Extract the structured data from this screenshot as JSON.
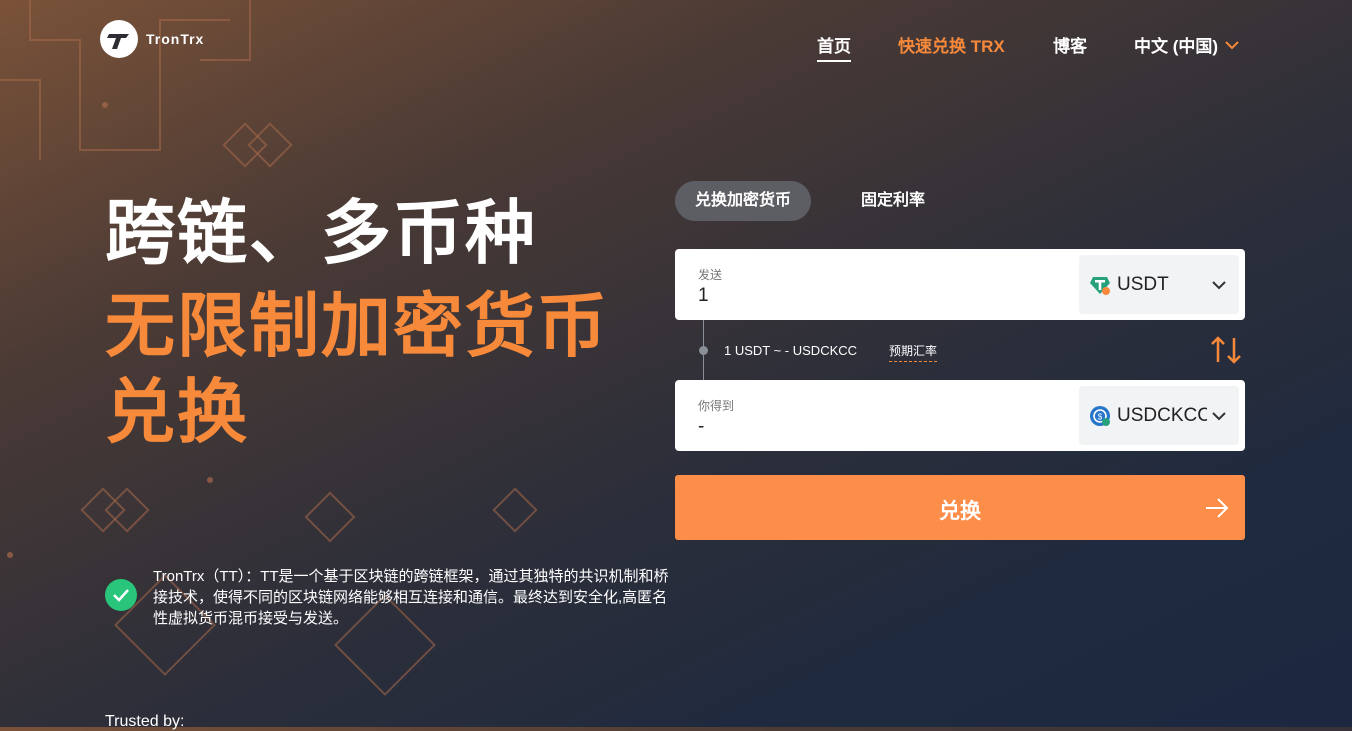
{
  "brand": {
    "name": "TronTrx"
  },
  "nav": {
    "home": "首页",
    "swap": "快速兑换 TRX",
    "blog": "博客",
    "language": "中文 (中国)"
  },
  "hero": {
    "line1": "跨链、多币种",
    "line2": "无限制加密货币",
    "line3": "兑换"
  },
  "description": "TronTrx（TT）：TT是一个基于区块链的跨链框架，通过其独特的共识机制和桥接技术，使得不同的区块链网络能够相互连接和通信。最终达到安全化,高匿名性虚拟货币混币接受与发送。",
  "trusted_by": "Trusted by:",
  "exchange": {
    "tabs": [
      "兑换加密货币",
      "固定利率"
    ],
    "send": {
      "label": "发送",
      "value": "1",
      "coin": "USDT",
      "coin_icon": "tether-icon"
    },
    "rate": {
      "text": "1 USDT ~ - USDCKCC",
      "link": "预期汇率"
    },
    "receive": {
      "label": "你得到",
      "value": "-",
      "coin": "USDCKCC",
      "coin_icon": "usdc-icon"
    },
    "submit": "兑换"
  },
  "colors": {
    "accent": "#f7893b",
    "button": "#fc8e49",
    "check": "#28c57a"
  }
}
